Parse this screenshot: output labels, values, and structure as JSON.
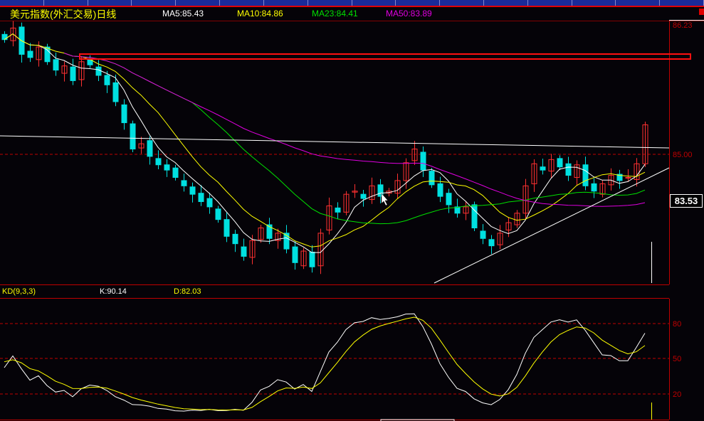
{
  "header": {
    "title": "美元指数(外汇交易)日线",
    "ma5": "MA5:85.43",
    "ma10": "MA10:84.86",
    "ma23": "MA23:84.41",
    "ma50": "MA50:83.89"
  },
  "indicator": {
    "name": "KD(9,3,3)",
    "k": "K:90.14",
    "d": "D:82.03"
  },
  "price_axis": {
    "top": "86.23",
    "mid": "85.00",
    "current": "83.53"
  },
  "kd_axis": {
    "high": "80",
    "mid": "50",
    "low": "20"
  },
  "colors": {
    "up": "#ff3030",
    "down": "#00e0e0",
    "ma5": "#ffffff",
    "ma10": "#ffff00",
    "ma23": "#00e000",
    "ma50": "#e000e0",
    "grid": "#c00000"
  },
  "chart_data": {
    "type": "candlestick",
    "title": "美元指数(外汇交易)日线",
    "ylim": [
      83.8,
      86.23
    ],
    "yticks": [
      85.0,
      86.23
    ],
    "close": [
      86.09,
      86.2,
      85.95,
      85.92,
      86.02,
      85.88,
      85.8,
      85.84,
      85.7,
      85.88,
      85.85,
      85.75,
      85.66,
      85.5,
      85.3,
      85.05,
      85.1,
      84.98,
      84.9,
      84.85,
      84.78,
      84.7,
      84.62,
      84.55,
      84.5,
      84.38,
      84.22,
      84.15,
      84.03,
      84.18,
      84.3,
      84.2,
      84.25,
      84.1,
      83.97,
      84.08,
      83.93,
      84.25,
      84.51,
      84.45,
      84.62,
      84.65,
      84.58,
      84.7,
      84.6,
      84.65,
      84.75,
      84.92,
      85.05,
      84.85,
      84.71,
      84.6,
      84.52,
      84.44,
      84.5,
      84.3,
      84.2,
      84.13,
      84.25,
      84.35,
      84.44,
      84.7,
      84.91,
      84.85,
      84.95,
      84.88,
      84.8,
      84.9,
      84.7,
      84.65,
      84.72,
      84.8,
      84.75,
      84.78,
      84.91,
      85.28
    ],
    "moving_averages": [
      5,
      10,
      23,
      50
    ],
    "kd_params": [
      9,
      3,
      3
    ],
    "kd_levels": [
      20,
      50,
      80
    ]
  }
}
